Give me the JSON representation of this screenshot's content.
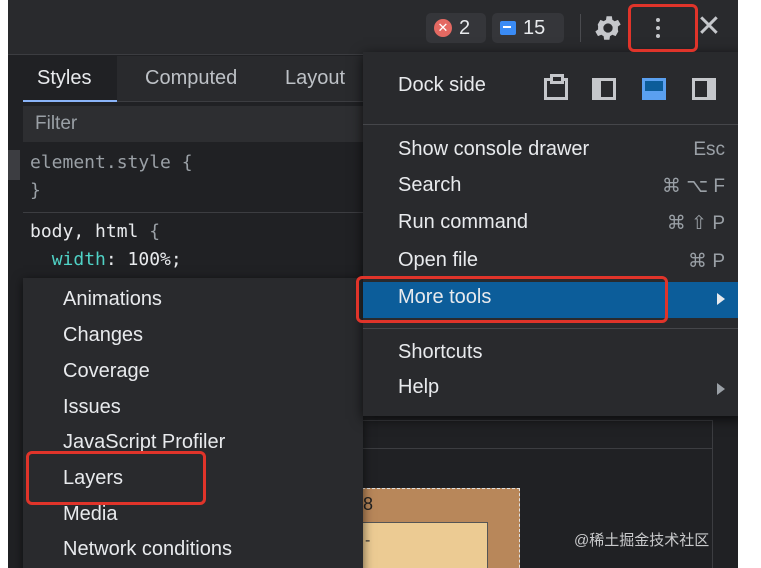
{
  "toolbar": {
    "error_count": "2",
    "message_count": "15"
  },
  "tabs": [
    "Styles",
    "Computed",
    "Layout"
  ],
  "filter_placeholder": "Filter",
  "styles": {
    "element_rule_open": "element.style {",
    "element_rule_close": "}",
    "body_selector": "body, html",
    "body_brace": " {",
    "width_prop": "width",
    "width_value": ": 100%;"
  },
  "box_model": {
    "value": "8",
    "dash": "-"
  },
  "menu": {
    "dock_side_label": "Dock side",
    "items": [
      {
        "label": "Show console drawer",
        "shortcut": "Esc"
      },
      {
        "label": "Search",
        "shortcut": "⌘ ⌥ F"
      },
      {
        "label": "Run command",
        "shortcut": "⌘ ⇧ P"
      },
      {
        "label": "Open file",
        "shortcut": "⌘ P"
      },
      {
        "label": "More tools",
        "shortcut": ""
      },
      {
        "label": "Shortcuts",
        "shortcut": ""
      },
      {
        "label": "Help",
        "shortcut": ""
      }
    ]
  },
  "more_tools": [
    "Animations",
    "Changes",
    "Coverage",
    "Issues",
    "JavaScript Profiler",
    "Layers",
    "Media",
    "Network conditions"
  ],
  "watermark": "@稀土掘金技术社区",
  "colors": {
    "panel": "#202124",
    "menu": "#292a2d",
    "selected": "#0c5d9a",
    "highlight": "#e0342a"
  }
}
